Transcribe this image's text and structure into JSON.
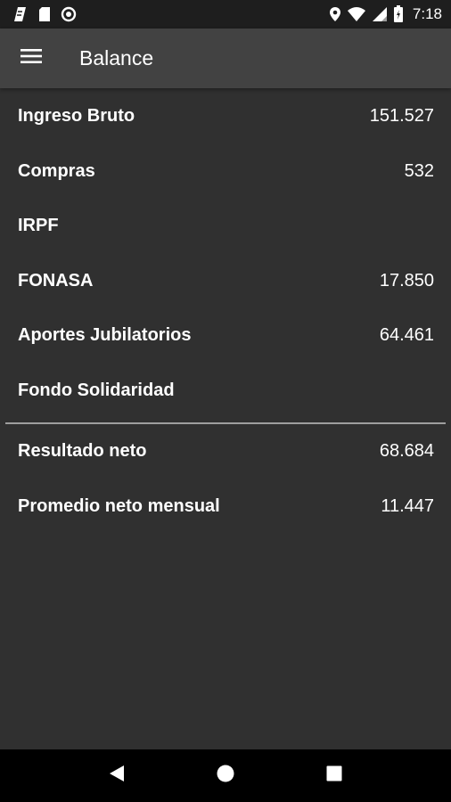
{
  "status_bar": {
    "time": "7:18",
    "icons_left": [
      "notification-icon",
      "sd-card-icon",
      "circle-app-icon"
    ],
    "icons_right": [
      "location-icon",
      "wifi-icon",
      "cell-signal-icon",
      "battery-icon"
    ]
  },
  "app_bar": {
    "title": "Balance",
    "menu_icon": "hamburger-menu-icon"
  },
  "balance": {
    "rows": [
      {
        "label": "Ingreso Bruto",
        "value": "151.527"
      },
      {
        "label": "Compras",
        "value": "532"
      },
      {
        "label": "IRPF",
        "value": ""
      },
      {
        "label": "FONASA",
        "value": "17.850"
      },
      {
        "label": "Aportes Jubilatorios",
        "value": "64.461"
      },
      {
        "label": "Fondo Solidaridad",
        "value": ""
      }
    ],
    "totals": [
      {
        "label": "Resultado neto",
        "value": "68.684"
      },
      {
        "label": "Promedio neto mensual",
        "value": "11.447"
      }
    ]
  },
  "nav_bar": {
    "buttons": [
      "back-icon",
      "home-icon",
      "recents-icon"
    ]
  },
  "colors": {
    "background": "#303030",
    "app_bar": "#424242",
    "status_bar": "#1e1e1e",
    "nav_bar": "#000000",
    "divider": "#9e9e9e",
    "text": "#ffffff"
  }
}
